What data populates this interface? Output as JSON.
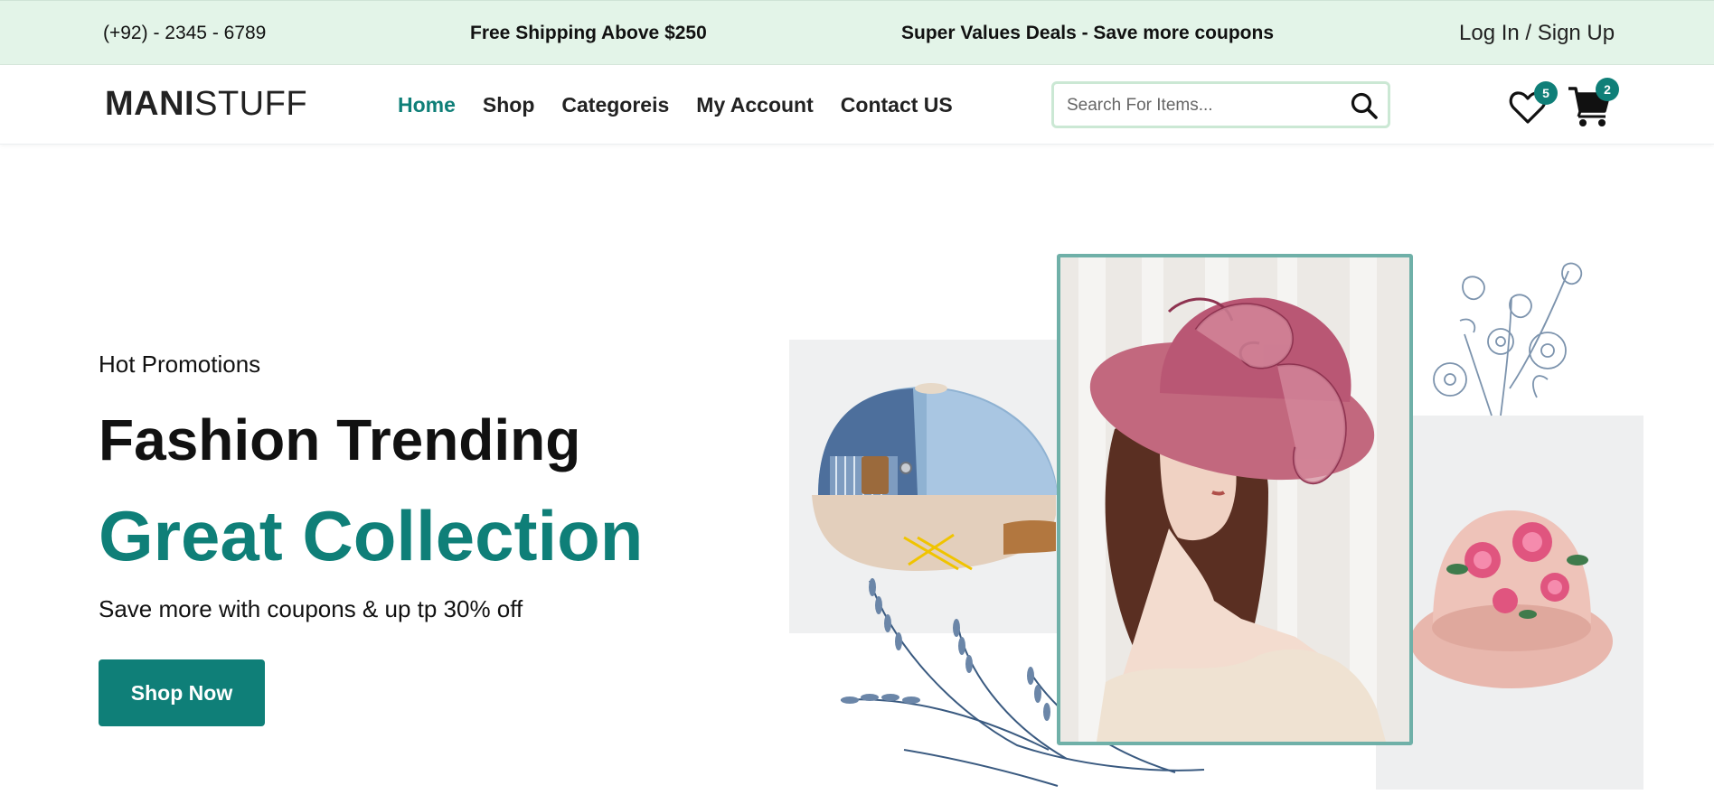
{
  "topbar": {
    "phone": "(+92) - 2345 - 6789",
    "shipping": "Free Shipping Above $250",
    "deals": "Super Values Deals - Save more coupons",
    "login": "Log In / Sign Up"
  },
  "header": {
    "logo_bold": "MANI",
    "logo_light": "STUFF",
    "nav": {
      "home": "Home",
      "shop": "Shop",
      "categories": "Categoreis",
      "account": "My Account",
      "contact": "Contact US"
    },
    "search_placeholder": "Search For Items...",
    "wishlist_count": "5",
    "cart_count": "2",
    "icons": [
      "search-icon",
      "heart-icon",
      "cart-icon"
    ]
  },
  "hero": {
    "label": "Hot Promotions",
    "title": "Fashion Trending",
    "subtitle": "Great Collection",
    "description": "Save more with coupons & up tp 30% off",
    "button": "Shop Now"
  },
  "colors": {
    "accent": "#0f7f78",
    "topbar_bg": "#e3f4e8",
    "search_border": "#cbe8d4",
    "frame_border": "#6fb0a8"
  }
}
